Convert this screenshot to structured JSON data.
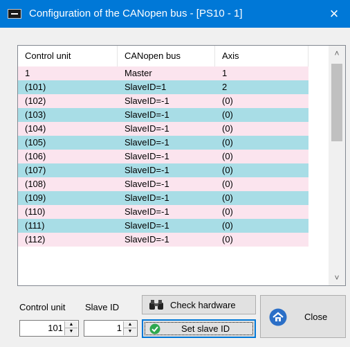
{
  "window": {
    "title": "Configuration of the CANopen bus - [PS10 - 1]",
    "close_symbol": "×"
  },
  "grid": {
    "columns": [
      "Control unit",
      "CANopen bus",
      "Axis"
    ],
    "rows": [
      {
        "unit": "1",
        "bus": "Master",
        "axis": "1"
      },
      {
        "unit": "(101)",
        "bus": "SlaveID=1",
        "axis": "2"
      },
      {
        "unit": "(102)",
        "bus": "SlaveID=-1",
        "axis": "(0)"
      },
      {
        "unit": "(103)",
        "bus": "SlaveID=-1",
        "axis": "(0)"
      },
      {
        "unit": "(104)",
        "bus": "SlaveID=-1",
        "axis": "(0)"
      },
      {
        "unit": "(105)",
        "bus": "SlaveID=-1",
        "axis": "(0)"
      },
      {
        "unit": "(106)",
        "bus": "SlaveID=-1",
        "axis": "(0)"
      },
      {
        "unit": "(107)",
        "bus": "SlaveID=-1",
        "axis": "(0)"
      },
      {
        "unit": "(108)",
        "bus": "SlaveID=-1",
        "axis": "(0)"
      },
      {
        "unit": "(109)",
        "bus": "SlaveID=-1",
        "axis": "(0)"
      },
      {
        "unit": "(110)",
        "bus": "SlaveID=-1",
        "axis": "(0)"
      },
      {
        "unit": "(111)",
        "bus": "SlaveID=-1",
        "axis": "(0)"
      },
      {
        "unit": "(112)",
        "bus": "SlaveID=-1",
        "axis": "(0)"
      }
    ],
    "row_colors": {
      "odd": "#fbe4ee",
      "even": "#a8dde6"
    }
  },
  "controls": {
    "control_unit_label": "Control unit",
    "slave_id_label": "Slave ID",
    "control_unit_value": "101",
    "slave_id_value": "1",
    "check_hardware_label": "Check hardware",
    "set_slave_id_label": "Set slave ID",
    "close_label": "Close"
  },
  "icons": {
    "title": "app-icon",
    "check_hardware": "binoculars-icon",
    "set_slave_id": "check-icon",
    "close": "home-icon"
  },
  "colors": {
    "titlebar": "#0078d7",
    "window_bg": "#f0f0f0"
  }
}
